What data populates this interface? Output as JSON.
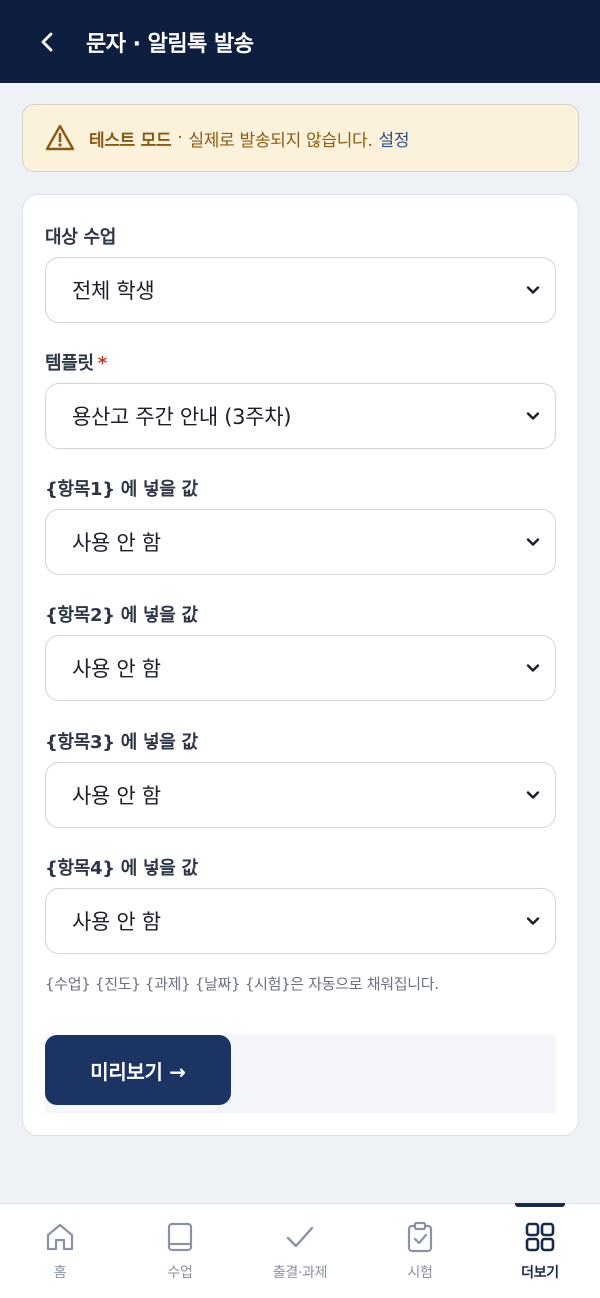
{
  "header": {
    "title": "문자 · 알림톡 발송"
  },
  "banner": {
    "strong": "테스트 모드",
    "separator": "·",
    "message": "실제로 발송되지 않습니다.",
    "link": "설정"
  },
  "form": {
    "target": {
      "label": "대상 수업",
      "value": "전체 학생"
    },
    "template": {
      "label": "템플릿",
      "required_mark": "*",
      "value": "용산고 주간 안내 (3주차)"
    },
    "fields": [
      {
        "label": "{항목1} 에 넣을 값",
        "value": "사용 안 함"
      },
      {
        "label": "{항목2} 에 넣을 값",
        "value": "사용 안 함"
      },
      {
        "label": "{항목3} 에 넣을 값",
        "value": "사용 안 함"
      },
      {
        "label": "{항목4} 에 넣을 값",
        "value": "사용 안 함"
      }
    ],
    "hint": "{수업} {진도} {과제} {날짜} {시험}은 자동으로 채워집니다.",
    "preview_button": "미리보기 →"
  },
  "nav": {
    "items": [
      {
        "label": "홈",
        "icon": "home-icon"
      },
      {
        "label": "수업",
        "icon": "book-icon"
      },
      {
        "label": "출결·과제",
        "icon": "check-icon"
      },
      {
        "label": "시험",
        "icon": "clipboard-icon"
      },
      {
        "label": "더보기",
        "icon": "grid-icon"
      }
    ]
  },
  "colors": {
    "header_bg": "#0e1e3f",
    "banner_bg": "#fcf2dc",
    "banner_text": "#8a5a14",
    "link": "#2a4f8a",
    "primary_button": "#1b3463",
    "active_nav": "#1b2a48"
  }
}
